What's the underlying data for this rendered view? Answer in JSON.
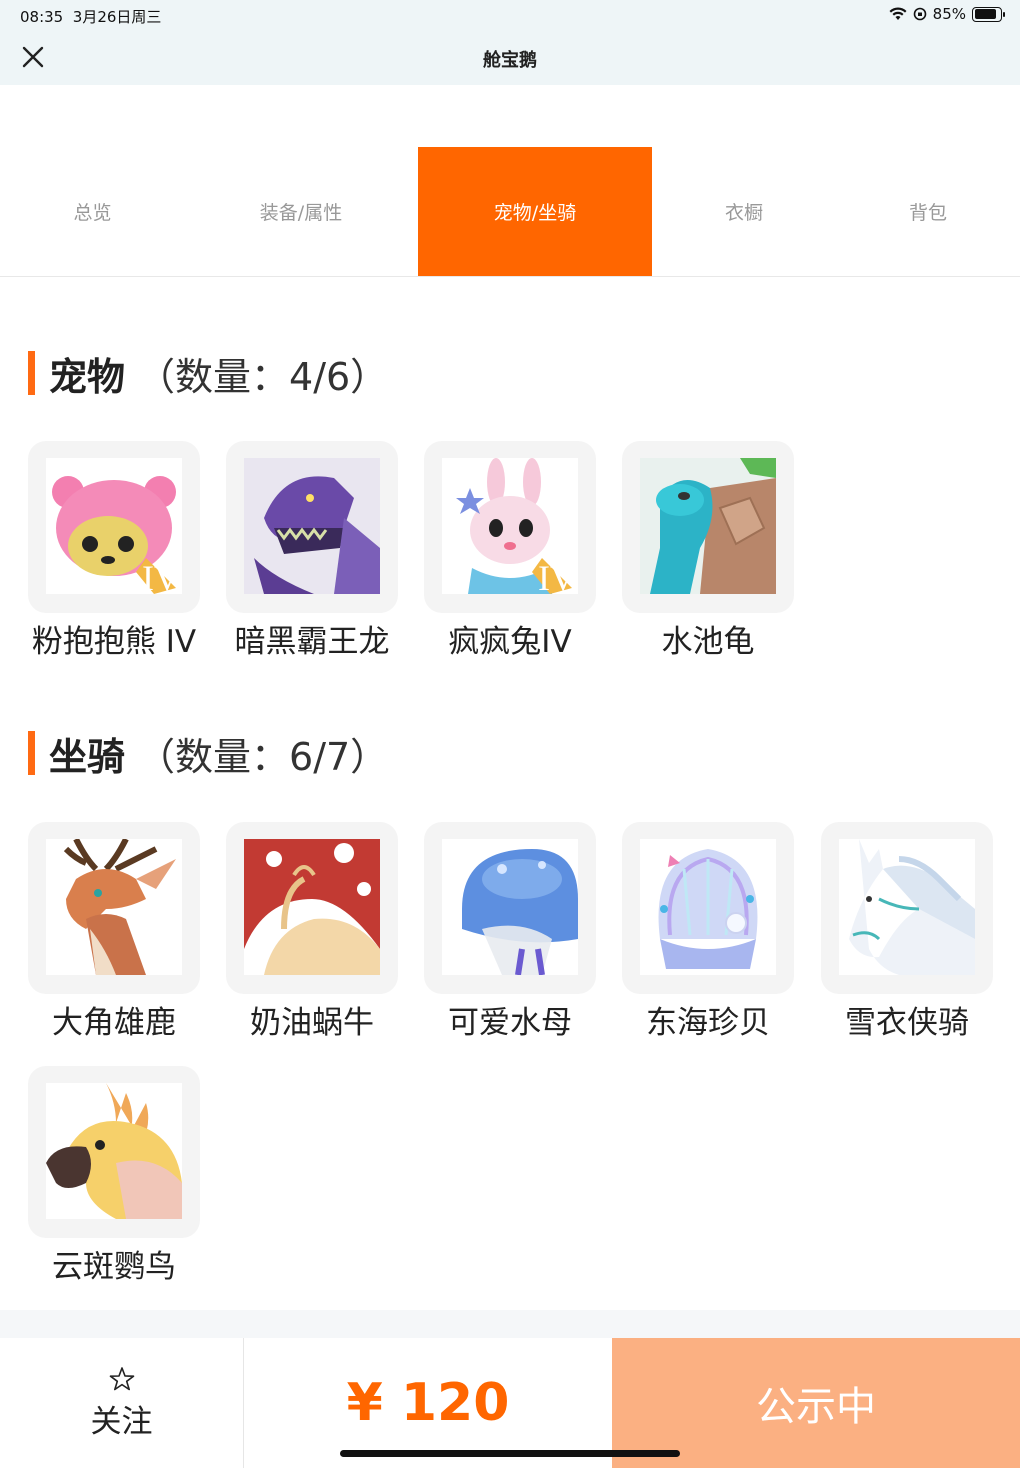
{
  "status_bar": {
    "time": "08:35",
    "date": "3月26日周三",
    "battery": "85%",
    "battery_level": 0.85
  },
  "nav": {
    "title": "舱宝鹅",
    "close_icon": "close-icon"
  },
  "tabs": [
    {
      "label": "总览"
    },
    {
      "label": "装备/属性"
    },
    {
      "label": "宠物/坐骑",
      "active": true
    },
    {
      "label": "衣橱"
    },
    {
      "label": "背包"
    }
  ],
  "pets": {
    "title": "宠物",
    "count": "（数量：4/6）",
    "items": [
      {
        "name": "粉抱抱熊 IV",
        "icon": "pink-bear"
      },
      {
        "name": "暗黑霸王龙",
        "icon": "dark-trex"
      },
      {
        "name": "疯疯兔IV",
        "icon": "crazy-rabbit"
      },
      {
        "name": "水池龟",
        "icon": "pond-turtle"
      }
    ]
  },
  "mounts": {
    "title": "坐骑",
    "count": "（数量：6/7）",
    "items": [
      {
        "name": "大角雄鹿",
        "icon": "antler-deer"
      },
      {
        "name": "奶油蜗牛",
        "icon": "cream-snail"
      },
      {
        "name": "可爱水母",
        "icon": "cute-jellyfish"
      },
      {
        "name": "东海珍贝",
        "icon": "pearl-shell"
      },
      {
        "name": "雪衣侠骑",
        "icon": "snow-horse"
      },
      {
        "name": "云斑鹦鸟",
        "icon": "cloud-parrot"
      }
    ]
  },
  "bottom_bar": {
    "follow_label": "关注",
    "price": "¥ 120",
    "status_label": "公示中"
  }
}
